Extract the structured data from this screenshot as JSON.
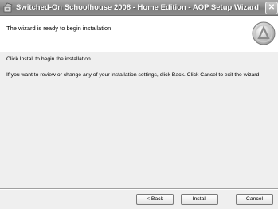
{
  "window": {
    "title": "Switched-On Schoolhouse 2008 - Home Edition - AOP Setup Wizard",
    "close_label": "✕"
  },
  "header": {
    "text": "The wizard is ready to begin installation."
  },
  "content": {
    "line1": "Click Install to begin the installation.",
    "line2": "If you want to review or change any of your installation settings, click Back. Click Cancel to exit the wizard."
  },
  "buttons": {
    "back": "< Back",
    "install": "Install",
    "cancel": "Cancel"
  },
  "icons": {
    "title_icon": "installer-icon",
    "logo": "aop-logo-icon"
  }
}
